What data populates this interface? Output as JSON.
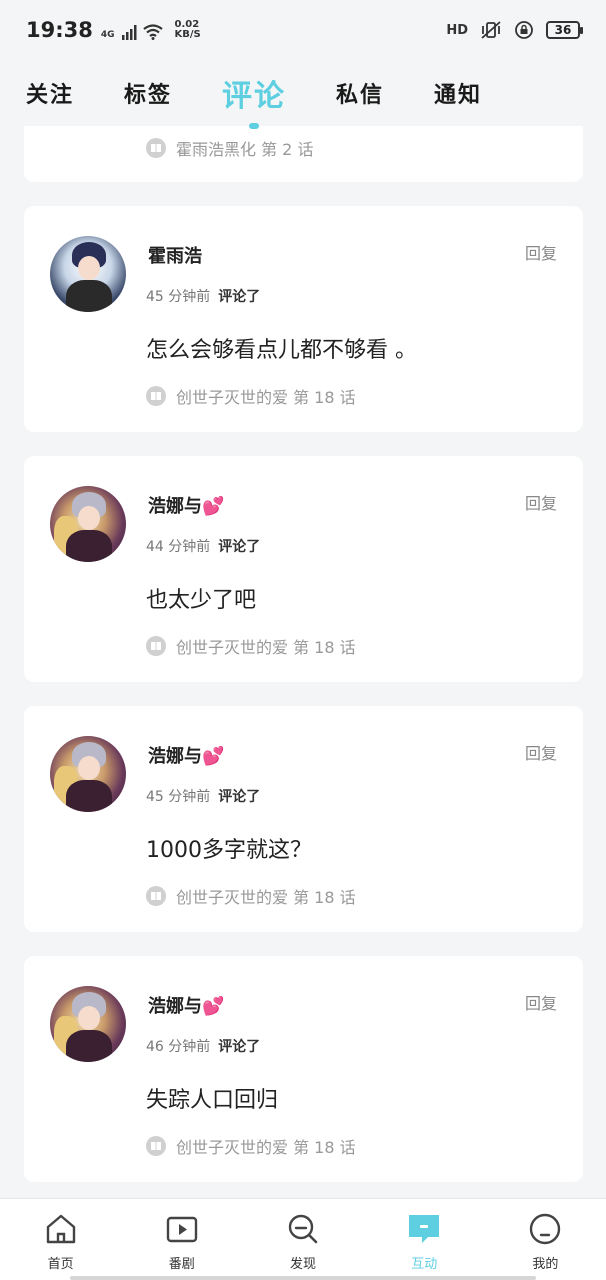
{
  "status_bar": {
    "time": "19:38",
    "network": "4G",
    "speed_value": "0.02",
    "speed_unit": "KB/S",
    "hd_label": "HD",
    "battery": "36"
  },
  "tabs": [
    {
      "label": "关注",
      "active": false
    },
    {
      "label": "标签",
      "active": false
    },
    {
      "label": "评论",
      "active": true
    },
    {
      "label": "私信",
      "active": false
    },
    {
      "label": "通知",
      "active": false
    }
  ],
  "partial_card": {
    "source": "霍雨浩黑化 第 2 话"
  },
  "comments": [
    {
      "name": "霍雨浩",
      "time": "45 分钟前",
      "action": "评论了",
      "reply": "回复",
      "content": "怎么会够看点儿都不够看 。",
      "source": "创世子灭世的爱 第 18 话"
    },
    {
      "name": "浩娜与💕",
      "time": "44 分钟前",
      "action": "评论了",
      "reply": "回复",
      "content": "也太少了吧",
      "source": "创世子灭世的爱 第 18 话"
    },
    {
      "name": "浩娜与💕",
      "time": "45 分钟前",
      "action": "评论了",
      "reply": "回复",
      "content": "1000多字就这？",
      "source": "创世子灭世的爱 第 18 话"
    },
    {
      "name": "浩娜与💕",
      "time": "46 分钟前",
      "action": "评论了",
      "reply": "回复",
      "content": "失踪人口回归",
      "source": "创世子灭世的爱 第 18 话"
    }
  ],
  "bottom_nav": [
    {
      "label": "首页",
      "icon": "home-icon"
    },
    {
      "label": "番剧",
      "icon": "play-icon"
    },
    {
      "label": "发现",
      "icon": "discover-icon"
    },
    {
      "label": "互动",
      "icon": "chat-icon",
      "active": true
    },
    {
      "label": "我的",
      "icon": "profile-icon"
    }
  ],
  "colors": {
    "accent": "#5dcfe0",
    "background": "#f4f5f6"
  }
}
